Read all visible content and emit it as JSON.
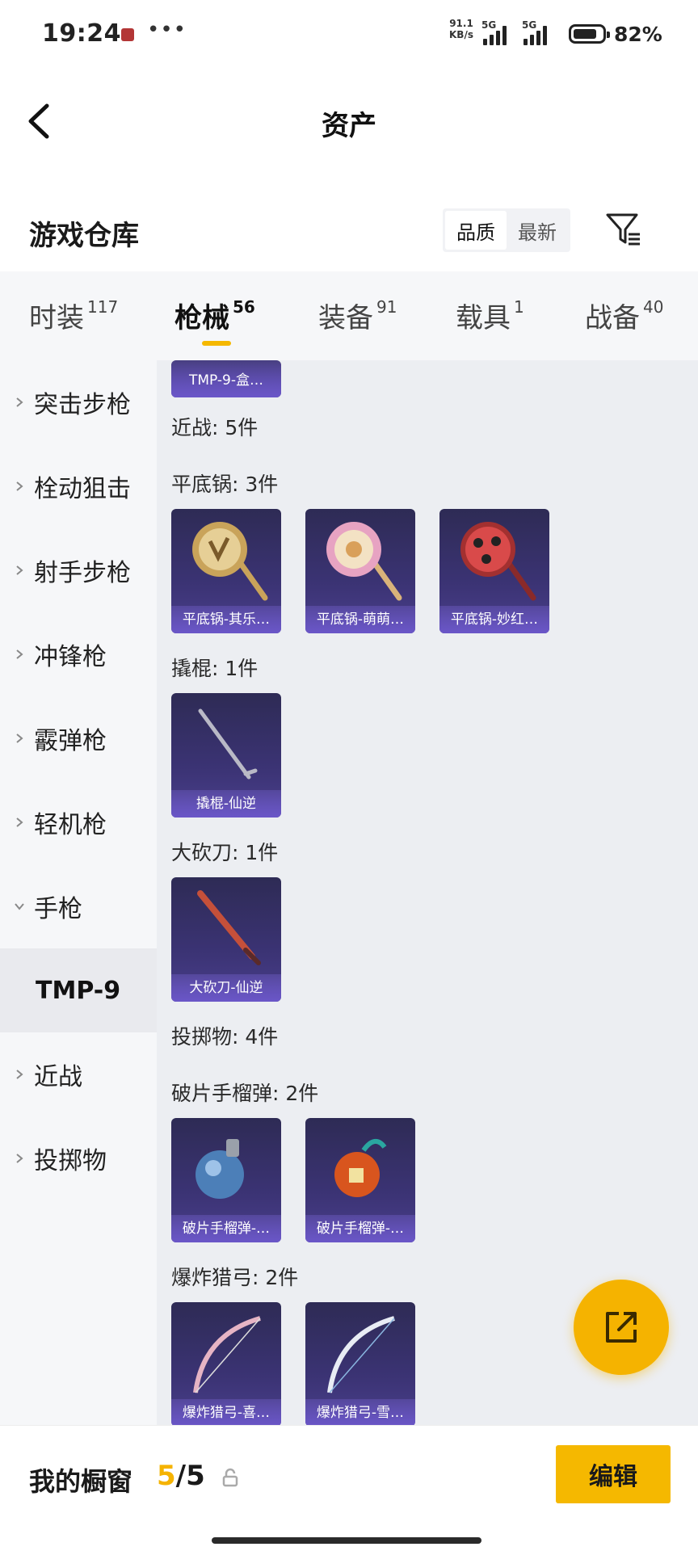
{
  "status_bar": {
    "time": "19:24",
    "more": "•••",
    "net_speed_value": "91.1",
    "net_speed_unit": "KB/s",
    "sim1_label": "5G",
    "sim2_label": "5G",
    "battery_percent": "82%",
    "battery_level": 0.82
  },
  "header": {
    "title": "资产"
  },
  "warehouse": {
    "title": "游戏仓库",
    "sort_options": [
      "品质",
      "最新"
    ],
    "sort_selected": "品质"
  },
  "tabs": [
    {
      "label": "时装",
      "count": "117"
    },
    {
      "label": "枪械",
      "count": "56",
      "active": true
    },
    {
      "label": "装备",
      "count": "91"
    },
    {
      "label": "载具",
      "count": "1"
    },
    {
      "label": "战备",
      "count": "40"
    }
  ],
  "sidebar": {
    "items": [
      {
        "label": "突击步枪"
      },
      {
        "label": "栓动狙击"
      },
      {
        "label": "射手步枪"
      },
      {
        "label": "冲锋枪"
      },
      {
        "label": "霰弹枪"
      },
      {
        "label": "轻机枪"
      },
      {
        "label": "手枪",
        "expanded": true
      },
      {
        "label": "TMP-9",
        "selected": true
      },
      {
        "label": "近战"
      },
      {
        "label": "投掷物"
      }
    ]
  },
  "content": {
    "cut_card_label": "TMP-9-盒…",
    "sections": [
      {
        "label": "近战: 5件"
      },
      {
        "label": "平底锅: 3件",
        "items": [
          "平底锅-其乐…",
          "平底锅-萌萌…",
          "平底锅-妙红…"
        ]
      },
      {
        "label": "撬棍: 1件",
        "items": [
          "撬棍-仙逆"
        ]
      },
      {
        "label": "大砍刀: 1件",
        "items": [
          "大砍刀-仙逆"
        ]
      },
      {
        "label": "投掷物: 4件"
      },
      {
        "label": "破片手榴弹: 2件",
        "items": [
          "破片手榴弹-…",
          "破片手榴弹-…"
        ]
      },
      {
        "label": "爆炸猎弓: 2件",
        "items": [
          "爆炸猎弓-喜…",
          "爆炸猎弓-雪…"
        ]
      }
    ]
  },
  "bottom": {
    "label": "我的橱窗",
    "used": "5",
    "slash": "/",
    "total": "5",
    "edit_label": "编辑"
  },
  "colors": {
    "accent": "#f5b800",
    "card_bg": "#3b3374",
    "card_label_bg": "#6a56c8"
  }
}
